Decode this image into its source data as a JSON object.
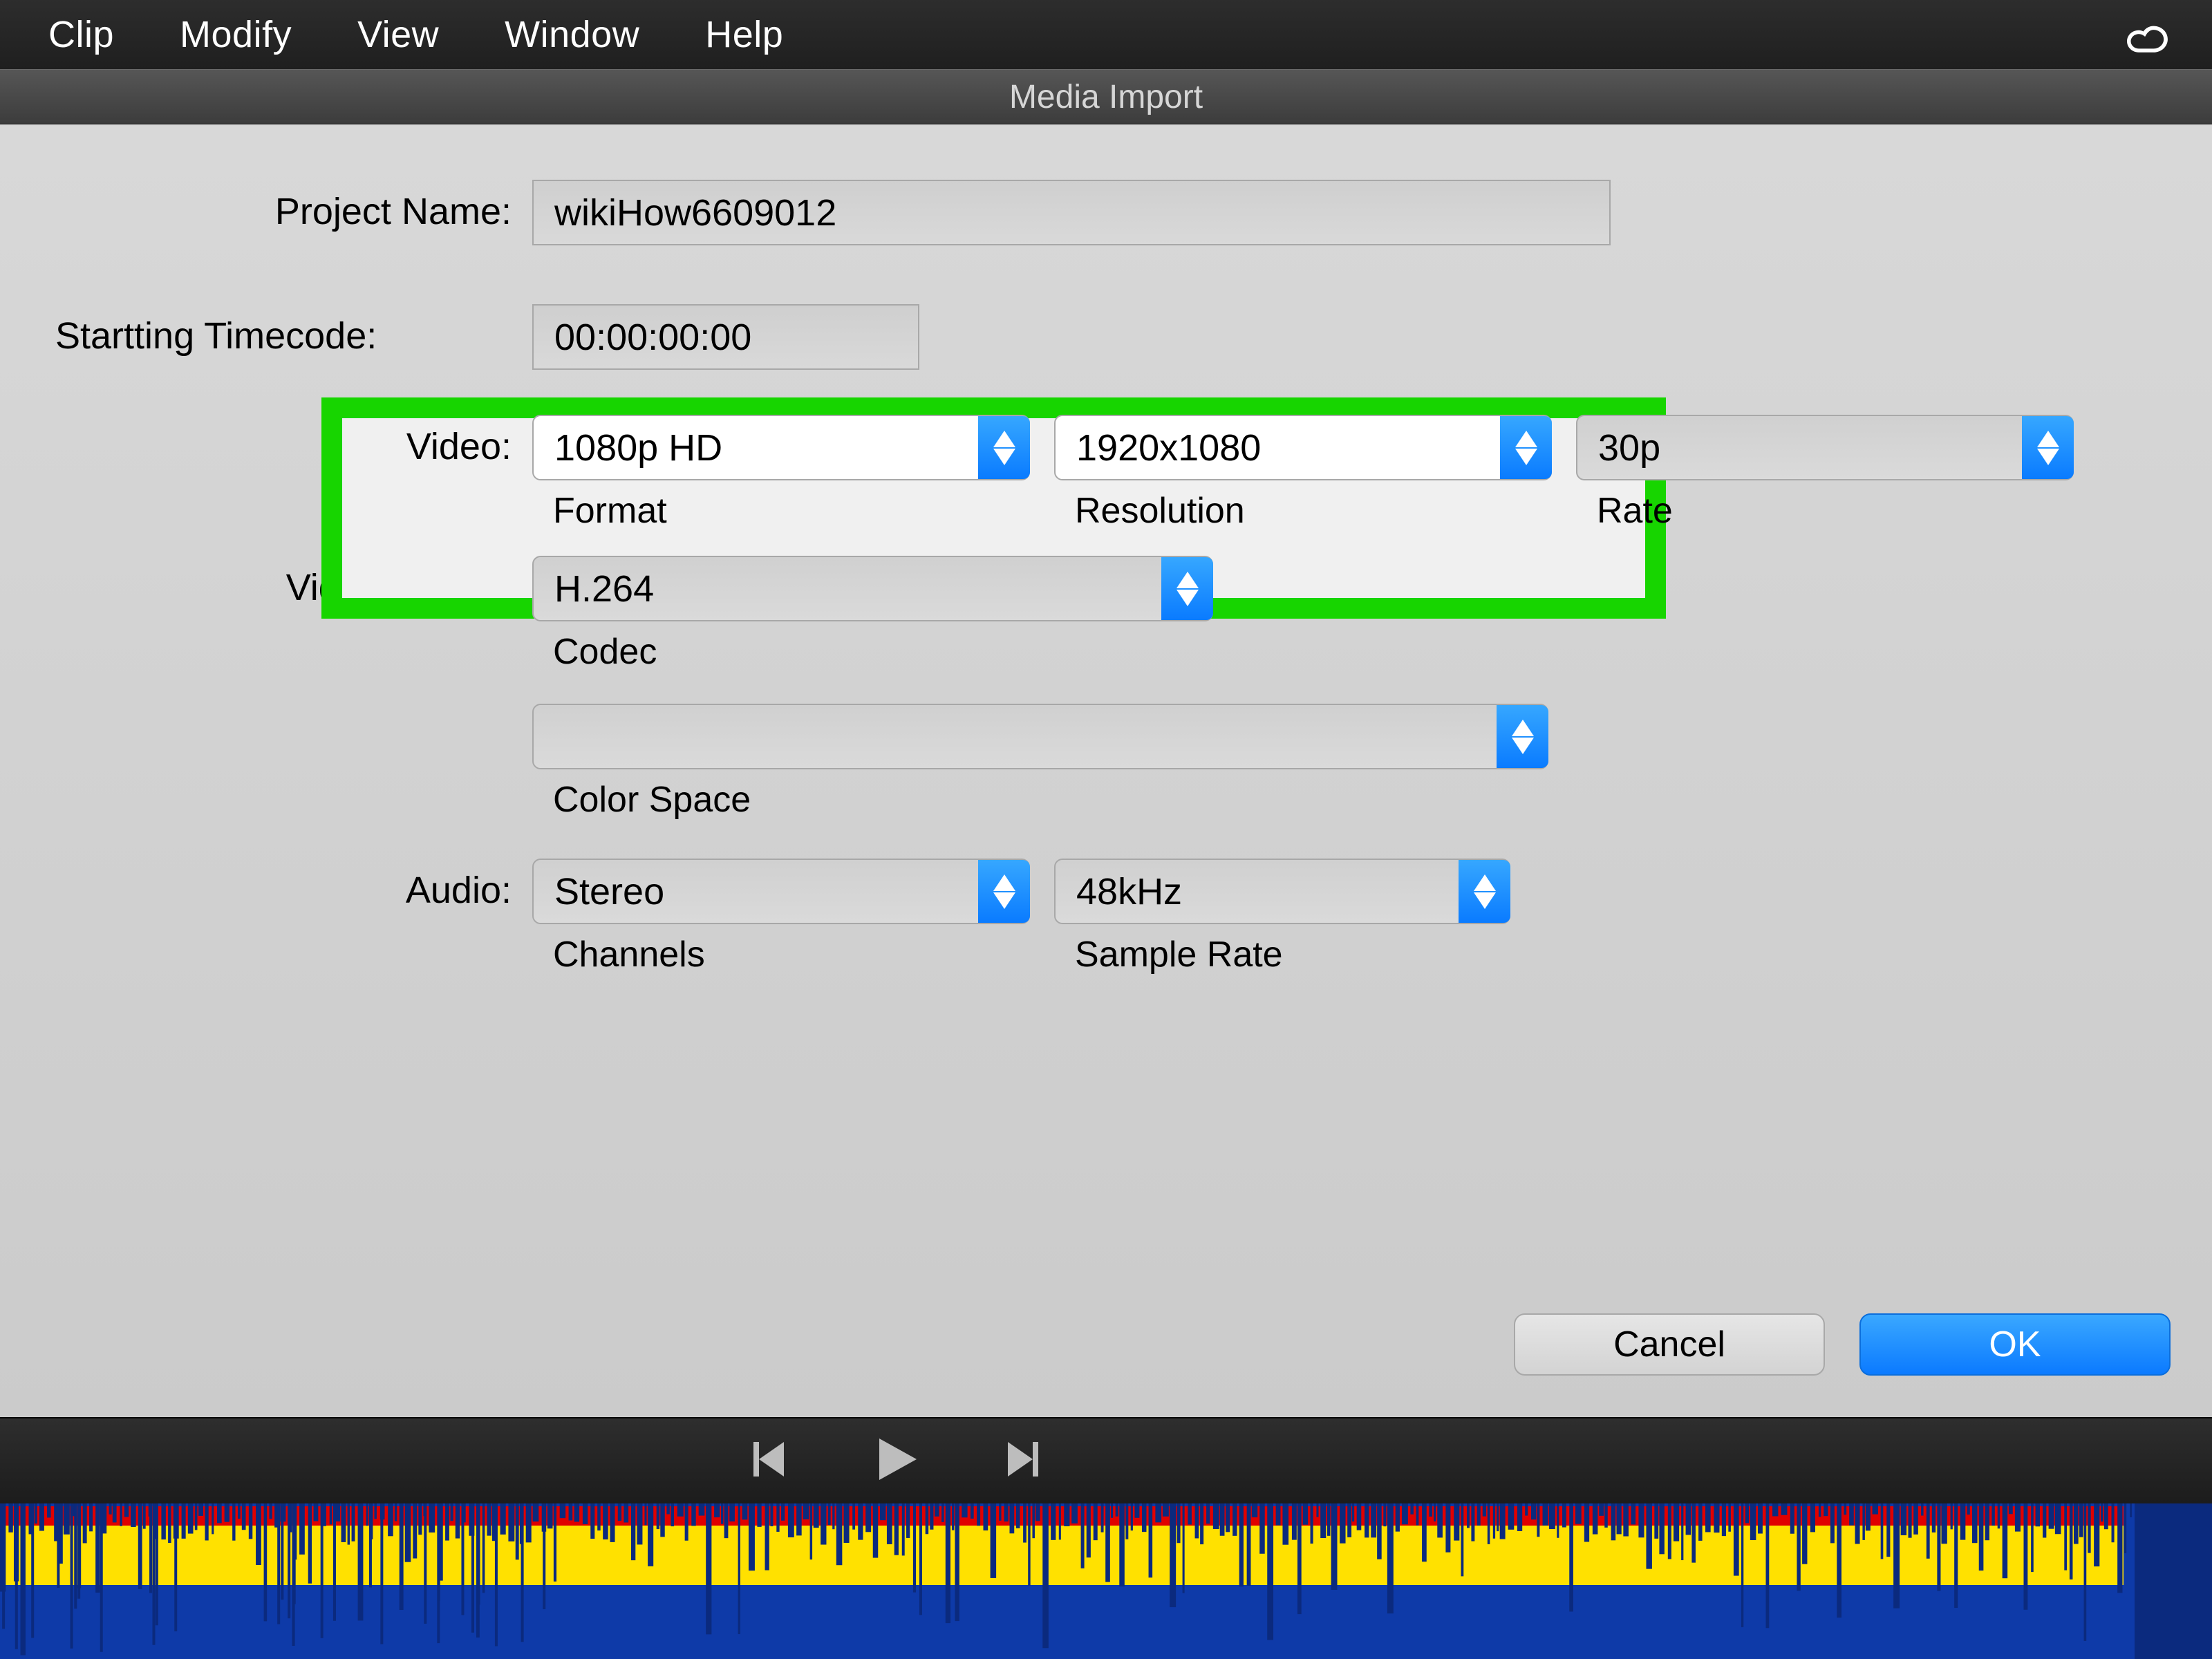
{
  "menubar": {
    "items": [
      "Clip",
      "Modify",
      "View",
      "Window",
      "Help"
    ]
  },
  "titlebar": {
    "title": "Media Import"
  },
  "form": {
    "projectName": {
      "label": "Project Name:",
      "value": "wikiHow6609012"
    },
    "timecode": {
      "label": "Startting Timecode:",
      "value": "00:00:00:00"
    },
    "video": {
      "label": "Video:",
      "format": {
        "value": "1080p HD",
        "sublabel": "Format"
      },
      "resolution": {
        "value": "1920x1080",
        "sublabel": "Resolution"
      },
      "rate": {
        "value": "30p",
        "sublabel": "Rate"
      }
    },
    "videoCodec": {
      "label": "Video Coded:",
      "codec": {
        "value": "H.264",
        "sublabel": "Codec"
      }
    },
    "colorSpace": {
      "value": "",
      "sublabel": "Color Space"
    },
    "audio": {
      "label": "Audio:",
      "channels": {
        "value": "Stereo",
        "sublabel": "Channels"
      },
      "sampleRate": {
        "value": "48kHz",
        "sublabel": "Sample Rate"
      }
    },
    "buttons": {
      "cancel": "Cancel",
      "ok": "OK"
    }
  },
  "highlightColor": "#17d500"
}
